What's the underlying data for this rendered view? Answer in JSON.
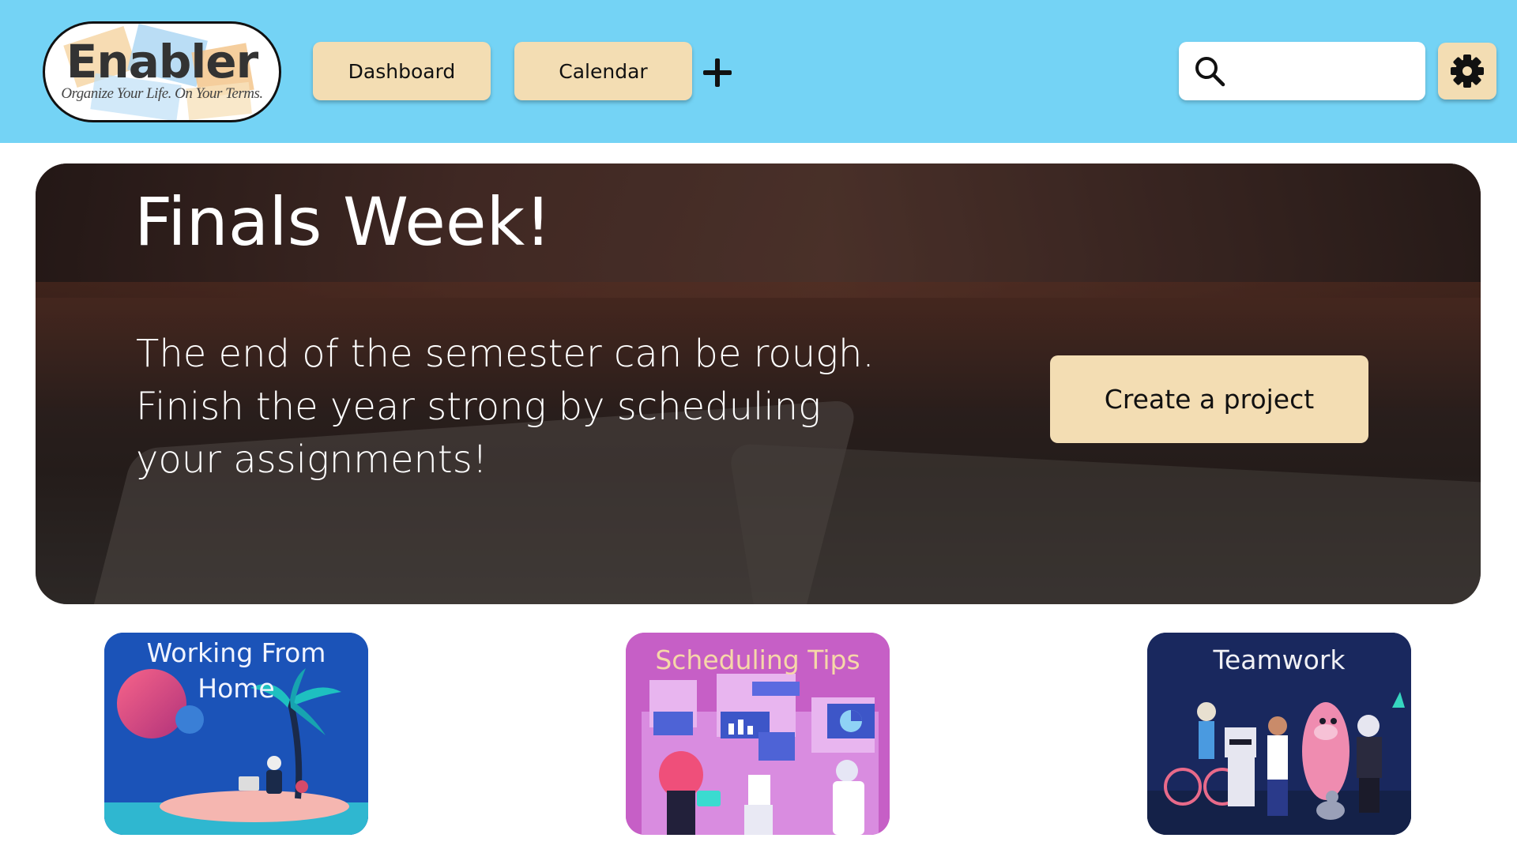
{
  "header": {
    "logo": {
      "title": "Enabler",
      "tagline": "Organize Your Life. On Your Terms."
    },
    "nav": [
      {
        "label": "Dashboard"
      },
      {
        "label": "Calendar"
      }
    ],
    "add_icon": "plus-icon",
    "search": {
      "placeholder": "",
      "value": "",
      "icon": "search-icon"
    },
    "settings_icon": "gear-icon"
  },
  "hero": {
    "title": "Finals Week!",
    "text_lines": [
      "The end of the semester can be rough.",
      "Finish the year strong by scheduling",
      "your assignments!"
    ],
    "cta_label": "Create a project"
  },
  "cards": [
    {
      "title_lines": [
        "Working From",
        "Home"
      ]
    },
    {
      "title_lines": [
        "Scheduling Tips"
      ]
    },
    {
      "title_lines": [
        "Teamwork"
      ]
    }
  ],
  "colors": {
    "header_bg": "#74d3f5",
    "button_bg": "#f3ddb3",
    "card_wfh_bg": "#1b53b8",
    "card_tips_bg": "#c65fc6",
    "card_team_bg": "#19285e"
  }
}
